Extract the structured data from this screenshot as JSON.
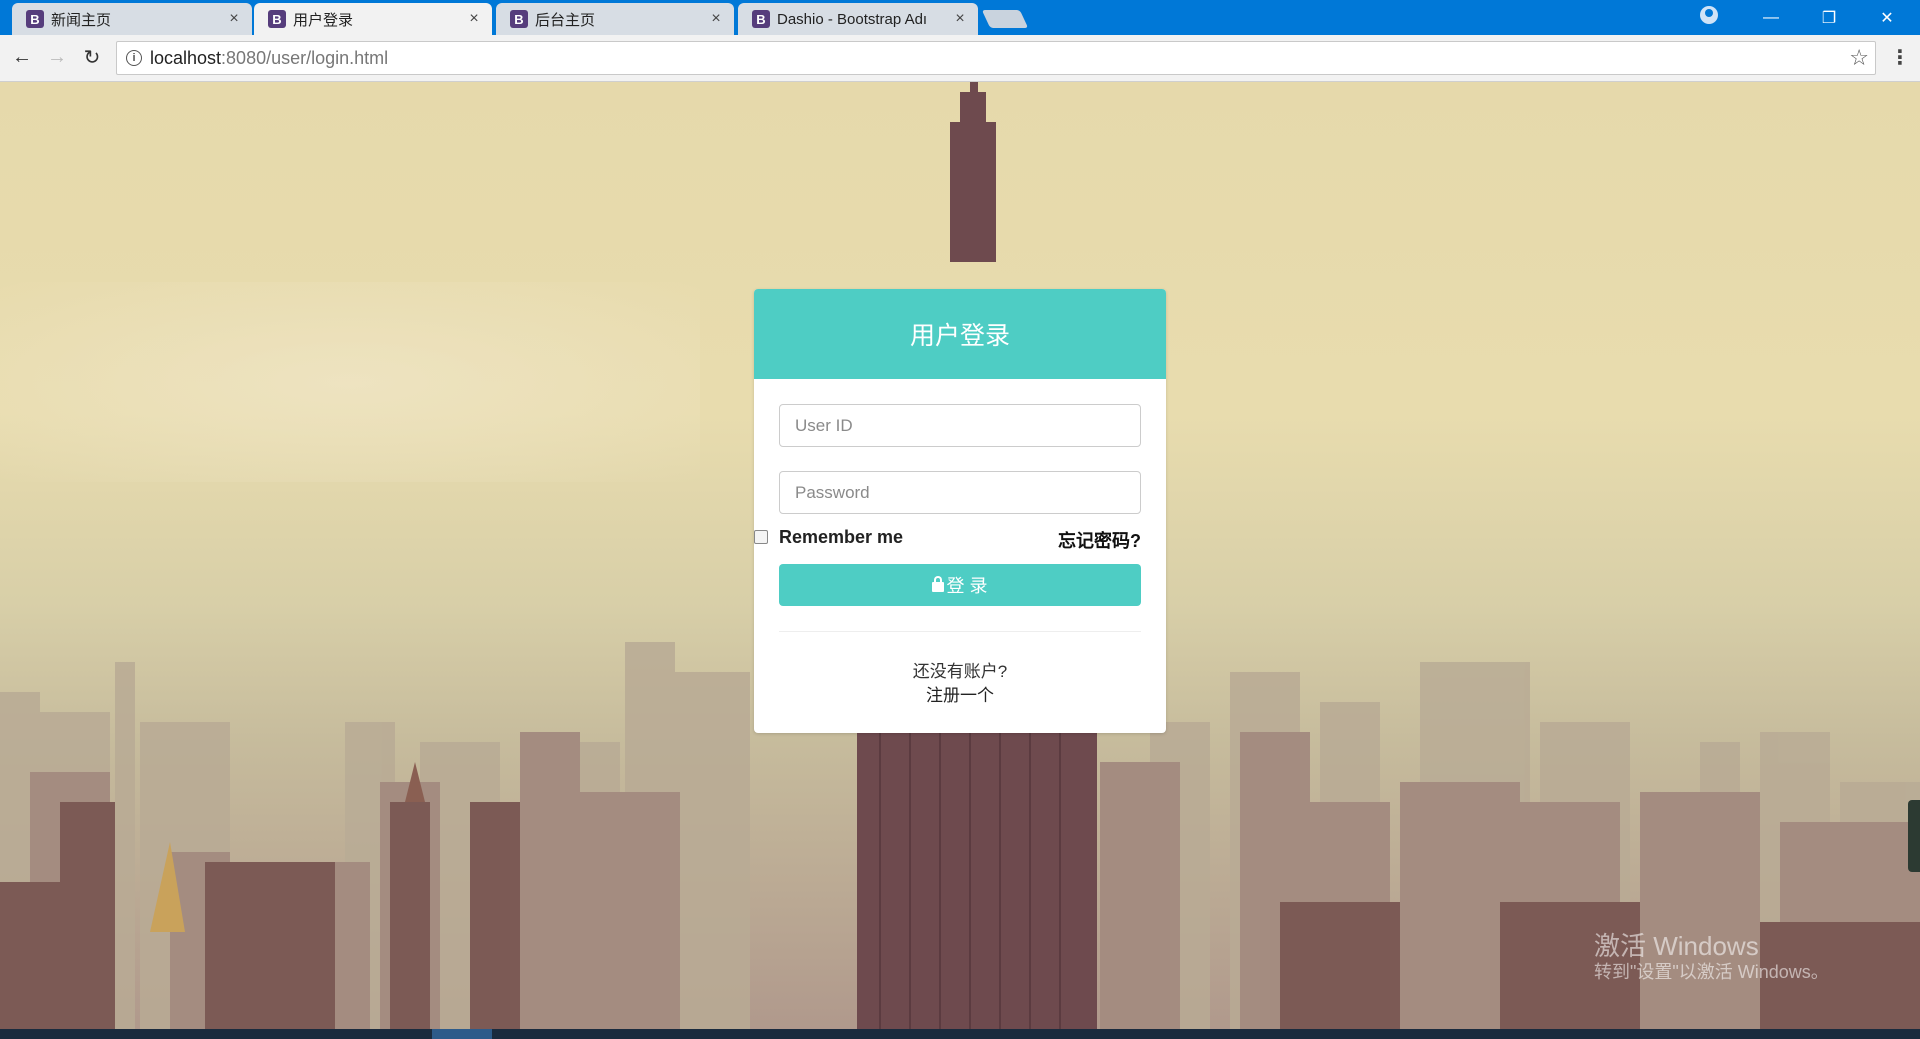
{
  "browser": {
    "tabs": [
      {
        "label": "新闻主页",
        "icon": "bootstrap-favicon",
        "active": false
      },
      {
        "label": "用户登录",
        "icon": "bootstrap-favicon",
        "active": true
      },
      {
        "label": "后台主页",
        "icon": "bootstrap-favicon",
        "active": false
      },
      {
        "label": "Dashio - Bootstrap Adı",
        "icon": "bootstrap-favicon",
        "active": false
      }
    ],
    "favicon_letter": "B",
    "close_glyph": "×",
    "url_host": "localhost",
    "url_rest": ":8080/user/login.html",
    "window_controls": {
      "minimize": "—",
      "restore": "❐",
      "close": "✕"
    }
  },
  "login": {
    "title": "用户登录",
    "userid_placeholder": "User ID",
    "password_placeholder": "Password",
    "remember_label": "Remember me",
    "remember_checked": false,
    "forgot_label": "忘记密码?",
    "submit_label": "登 录",
    "no_account_text": "还没有账户?",
    "register_label": "注册一个"
  },
  "colors": {
    "accent": "#4ecdc4",
    "titlebar": "#0078d7"
  },
  "watermark": {
    "line1": "激活 Windows",
    "line2": "转到\"设置\"以激活 Windows。"
  }
}
